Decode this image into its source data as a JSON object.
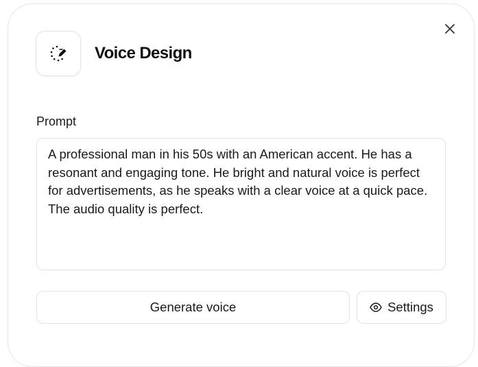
{
  "dialog": {
    "title": "Voice Design",
    "icon": "voice-design-icon",
    "close_icon": "close-icon"
  },
  "prompt": {
    "label": "Prompt",
    "value": "A professional man in his 50s with an American accent. He has a resonant and engaging tone. He bright and natural voice is perfect for advertisements, as he speaks with a clear voice at a quick pace. The audio quality is perfect."
  },
  "actions": {
    "generate_label": "Generate voice",
    "settings_label": "Settings",
    "settings_icon": "eye-icon"
  },
  "colors": {
    "text": "#1a1a1a",
    "border": "#e2e2e2",
    "background": "#ffffff"
  }
}
